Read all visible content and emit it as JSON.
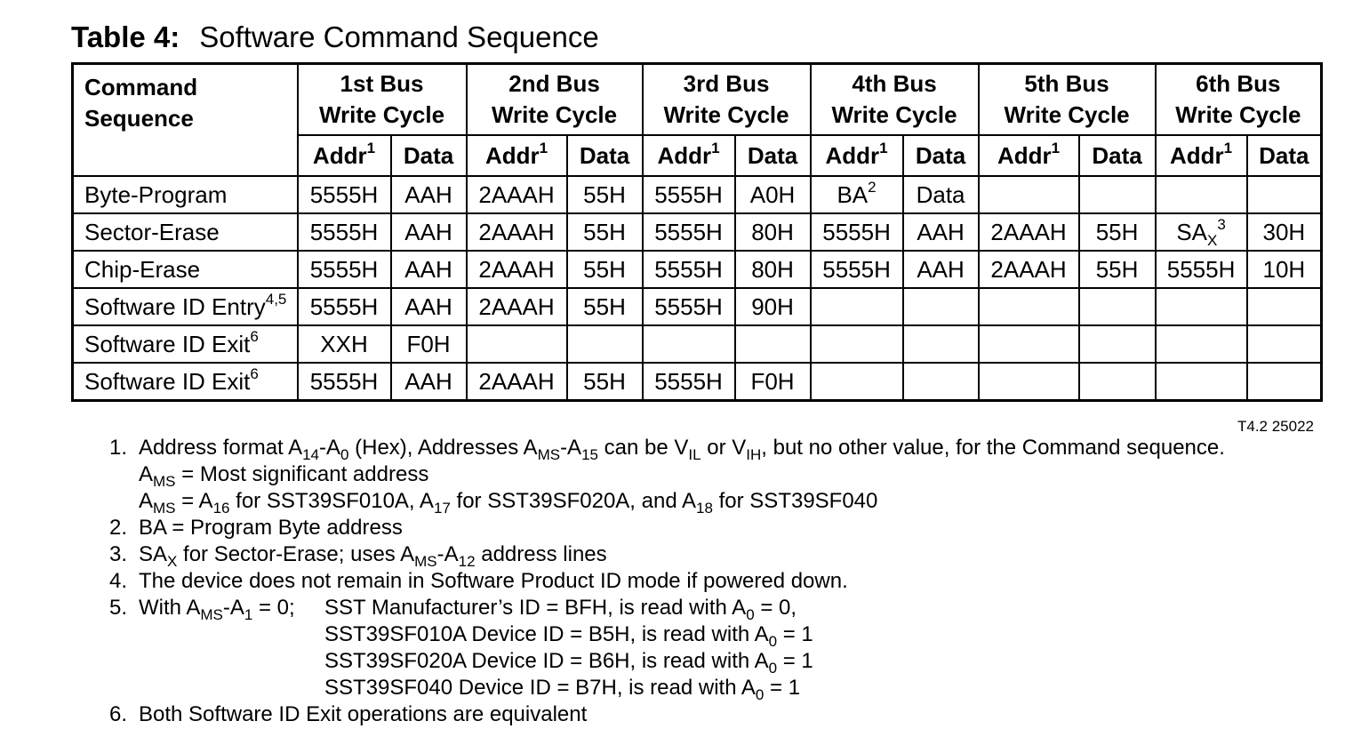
{
  "title": {
    "label": "Table 4:",
    "text": "Software Command Sequence"
  },
  "table": {
    "command_header_line1": "Command",
    "command_header_line2": "Sequence",
    "bus_cycles": [
      {
        "line1": "1st Bus",
        "line2": "Write Cycle"
      },
      {
        "line1": "2nd Bus",
        "line2": "Write Cycle"
      },
      {
        "line1": "3rd Bus",
        "line2": "Write Cycle"
      },
      {
        "line1": "4th Bus",
        "line2": "Write Cycle"
      },
      {
        "line1": "5th Bus",
        "line2": "Write Cycle"
      },
      {
        "line1": "6th Bus",
        "line2": "Write Cycle"
      }
    ],
    "addr_label": "Addr",
    "addr_sup": "1",
    "data_label": "Data",
    "rows": [
      {
        "command": "Byte-Program",
        "command_sup": "",
        "cells": [
          {
            "text": "5555H",
            "sub": "",
            "sup": ""
          },
          {
            "text": "AAH",
            "sub": "",
            "sup": ""
          },
          {
            "text": "2AAAH",
            "sub": "",
            "sup": ""
          },
          {
            "text": "55H",
            "sub": "",
            "sup": ""
          },
          {
            "text": "5555H",
            "sub": "",
            "sup": ""
          },
          {
            "text": "A0H",
            "sub": "",
            "sup": ""
          },
          {
            "text": "BA",
            "sub": "",
            "sup": "2"
          },
          {
            "text": "Data",
            "sub": "",
            "sup": ""
          },
          {
            "text": "",
            "sub": "",
            "sup": ""
          },
          {
            "text": "",
            "sub": "",
            "sup": ""
          },
          {
            "text": "",
            "sub": "",
            "sup": ""
          },
          {
            "text": "",
            "sub": "",
            "sup": ""
          }
        ]
      },
      {
        "command": "Sector-Erase",
        "command_sup": "",
        "cells": [
          {
            "text": "5555H",
            "sub": "",
            "sup": ""
          },
          {
            "text": "AAH",
            "sub": "",
            "sup": ""
          },
          {
            "text": "2AAAH",
            "sub": "",
            "sup": ""
          },
          {
            "text": "55H",
            "sub": "",
            "sup": ""
          },
          {
            "text": "5555H",
            "sub": "",
            "sup": ""
          },
          {
            "text": "80H",
            "sub": "",
            "sup": ""
          },
          {
            "text": "5555H",
            "sub": "",
            "sup": ""
          },
          {
            "text": "AAH",
            "sub": "",
            "sup": ""
          },
          {
            "text": "2AAAH",
            "sub": "",
            "sup": ""
          },
          {
            "text": "55H",
            "sub": "",
            "sup": ""
          },
          {
            "text": "SA",
            "sub": "X",
            "sup": "3"
          },
          {
            "text": "30H",
            "sub": "",
            "sup": ""
          }
        ]
      },
      {
        "command": "Chip-Erase",
        "command_sup": "",
        "cells": [
          {
            "text": "5555H",
            "sub": "",
            "sup": ""
          },
          {
            "text": "AAH",
            "sub": "",
            "sup": ""
          },
          {
            "text": "2AAAH",
            "sub": "",
            "sup": ""
          },
          {
            "text": "55H",
            "sub": "",
            "sup": ""
          },
          {
            "text": "5555H",
            "sub": "",
            "sup": ""
          },
          {
            "text": "80H",
            "sub": "",
            "sup": ""
          },
          {
            "text": "5555H",
            "sub": "",
            "sup": ""
          },
          {
            "text": "AAH",
            "sub": "",
            "sup": ""
          },
          {
            "text": "2AAAH",
            "sub": "",
            "sup": ""
          },
          {
            "text": "55H",
            "sub": "",
            "sup": ""
          },
          {
            "text": "5555H",
            "sub": "",
            "sup": ""
          },
          {
            "text": "10H",
            "sub": "",
            "sup": ""
          }
        ]
      },
      {
        "command": "Software ID Entry",
        "command_sup": "4,5",
        "cells": [
          {
            "text": "5555H",
            "sub": "",
            "sup": ""
          },
          {
            "text": "AAH",
            "sub": "",
            "sup": ""
          },
          {
            "text": "2AAAH",
            "sub": "",
            "sup": ""
          },
          {
            "text": "55H",
            "sub": "",
            "sup": ""
          },
          {
            "text": "5555H",
            "sub": "",
            "sup": ""
          },
          {
            "text": "90H",
            "sub": "",
            "sup": ""
          },
          {
            "text": "",
            "sub": "",
            "sup": ""
          },
          {
            "text": "",
            "sub": "",
            "sup": ""
          },
          {
            "text": "",
            "sub": "",
            "sup": ""
          },
          {
            "text": "",
            "sub": "",
            "sup": ""
          },
          {
            "text": "",
            "sub": "",
            "sup": ""
          },
          {
            "text": "",
            "sub": "",
            "sup": ""
          }
        ]
      },
      {
        "command": "Software ID Exit",
        "command_sup": "6",
        "cells": [
          {
            "text": "XXH",
            "sub": "",
            "sup": ""
          },
          {
            "text": "F0H",
            "sub": "",
            "sup": ""
          },
          {
            "text": "",
            "sub": "",
            "sup": ""
          },
          {
            "text": "",
            "sub": "",
            "sup": ""
          },
          {
            "text": "",
            "sub": "",
            "sup": ""
          },
          {
            "text": "",
            "sub": "",
            "sup": ""
          },
          {
            "text": "",
            "sub": "",
            "sup": ""
          },
          {
            "text": "",
            "sub": "",
            "sup": ""
          },
          {
            "text": "",
            "sub": "",
            "sup": ""
          },
          {
            "text": "",
            "sub": "",
            "sup": ""
          },
          {
            "text": "",
            "sub": "",
            "sup": ""
          },
          {
            "text": "",
            "sub": "",
            "sup": ""
          }
        ]
      },
      {
        "command": "Software ID Exit",
        "command_sup": "6",
        "cells": [
          {
            "text": "5555H",
            "sub": "",
            "sup": ""
          },
          {
            "text": "AAH",
            "sub": "",
            "sup": ""
          },
          {
            "text": "2AAAH",
            "sub": "",
            "sup": ""
          },
          {
            "text": "55H",
            "sub": "",
            "sup": ""
          },
          {
            "text": "5555H",
            "sub": "",
            "sup": ""
          },
          {
            "text": "F0H",
            "sub": "",
            "sup": ""
          },
          {
            "text": "",
            "sub": "",
            "sup": ""
          },
          {
            "text": "",
            "sub": "",
            "sup": ""
          },
          {
            "text": "",
            "sub": "",
            "sup": ""
          },
          {
            "text": "",
            "sub": "",
            "sup": ""
          },
          {
            "text": "",
            "sub": "",
            "sup": ""
          },
          {
            "text": "",
            "sub": "",
            "sup": ""
          }
        ]
      }
    ],
    "table_id": "T4.2 25022"
  },
  "notes": {
    "n1": {
      "num": "1.",
      "line1": [
        {
          "t": "Address format A"
        },
        {
          "sub": "14"
        },
        {
          "t": "-A"
        },
        {
          "sub": "0"
        },
        {
          "t": " (Hex), Addresses A"
        },
        {
          "sub": "MS"
        },
        {
          "t": "-A"
        },
        {
          "sub": "15"
        },
        {
          "t": " can be V"
        },
        {
          "sub": "IL"
        },
        {
          "t": " or V"
        },
        {
          "sub": "IH"
        },
        {
          "t": ", but no other value, for the Command sequence."
        }
      ],
      "line2": [
        {
          "t": "A"
        },
        {
          "sub": "MS"
        },
        {
          "t": " = Most significant address"
        }
      ],
      "line3": [
        {
          "t": "A"
        },
        {
          "sub": "MS"
        },
        {
          "t": " = A"
        },
        {
          "sub": "16"
        },
        {
          "t": " for SST39SF010A, A"
        },
        {
          "sub": "17"
        },
        {
          "t": " for SST39SF020A, and A"
        },
        {
          "sub": "18"
        },
        {
          "t": " for SST39SF040"
        }
      ]
    },
    "n2": {
      "num": "2.",
      "line": [
        {
          "t": "BA = Program Byte address"
        }
      ]
    },
    "n3": {
      "num": "3.",
      "line": [
        {
          "t": "SA"
        },
        {
          "sub": "X"
        },
        {
          "t": " for Sector-Erase; uses A"
        },
        {
          "sub": "MS"
        },
        {
          "t": "-A"
        },
        {
          "sub": "12"
        },
        {
          "t": " address lines"
        }
      ]
    },
    "n4": {
      "num": "4.",
      "line": [
        {
          "t": "The device does not remain in Software Product ID mode if powered down."
        }
      ]
    },
    "n5": {
      "num": "5.",
      "lead": [
        {
          "t": "With A"
        },
        {
          "sub": "MS"
        },
        {
          "t": "-A"
        },
        {
          "sub": "1"
        },
        {
          "t": " = 0;"
        }
      ],
      "ids": [
        [
          {
            "t": "SST Manufacturer’s ID = BFH, is read with A"
          },
          {
            "sub": "0"
          },
          {
            "t": " = 0,"
          }
        ],
        [
          {
            "t": "SST39SF010A Device ID = B5H, is read with A"
          },
          {
            "sub": "0"
          },
          {
            "t": " = 1"
          }
        ],
        [
          {
            "t": "SST39SF020A Device ID = B6H, is read with A"
          },
          {
            "sub": "0"
          },
          {
            "t": " = 1"
          }
        ],
        [
          {
            "t": "SST39SF040 Device ID = B7H, is read with A"
          },
          {
            "sub": "0"
          },
          {
            "t": " = 1"
          }
        ]
      ]
    },
    "n6": {
      "num": "6.",
      "line": [
        {
          "t": "Both Software ID Exit operations are equivalent"
        }
      ]
    }
  }
}
